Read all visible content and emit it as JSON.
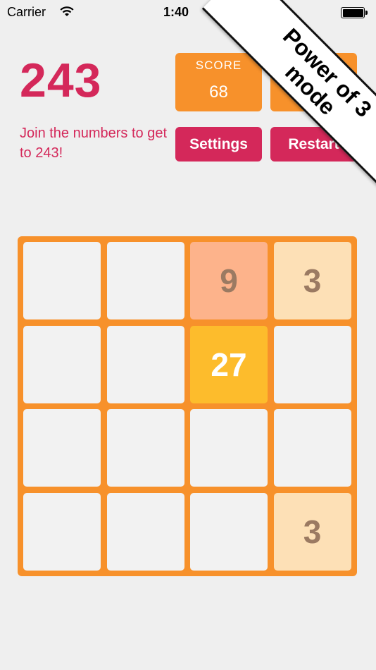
{
  "status_bar": {
    "carrier": "Carrier",
    "time": "1:40"
  },
  "game": {
    "title": "243",
    "tagline": "Join the numbers to get to 243!",
    "score_label": "SCORE",
    "score_value": "68",
    "best_label": "",
    "best_value": "",
    "settings_label": "Settings",
    "restart_label": "Restart"
  },
  "banner": {
    "line1": "Power of 3",
    "line2": "mode"
  },
  "board": {
    "size": 4,
    "cells": [
      [
        "",
        "",
        "9",
        "3"
      ],
      [
        "",
        "",
        "27",
        ""
      ],
      [
        "",
        "",
        "",
        ""
      ],
      [
        "",
        "",
        "",
        "3"
      ]
    ]
  },
  "colors": {
    "accent": "#d4285a",
    "board": "#f7912b",
    "tile_3": "#fde0b6",
    "tile_9": "#fdb38b",
    "tile_27": "#fdbc2c",
    "empty": "#f2f2f2"
  }
}
